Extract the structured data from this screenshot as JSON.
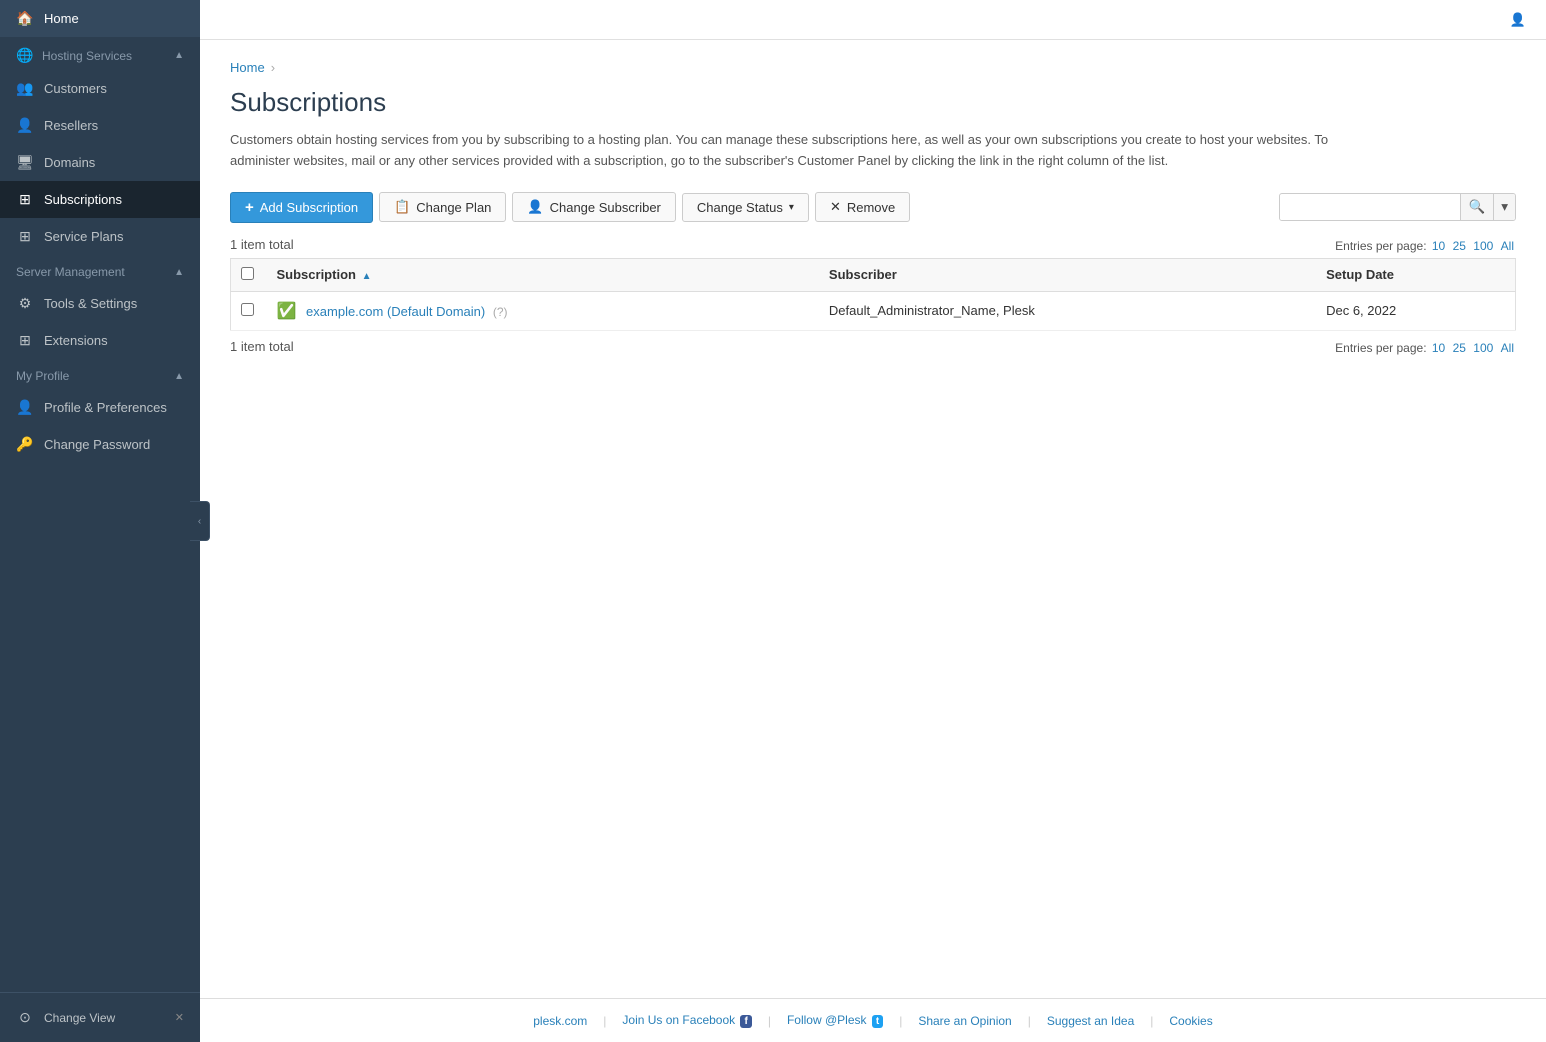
{
  "sidebar": {
    "home_label": "Home",
    "hosting_services_label": "Hosting Services",
    "customers_label": "Customers",
    "resellers_label": "Resellers",
    "domains_label": "Domains",
    "subscriptions_label": "Subscriptions",
    "service_plans_label": "Service Plans",
    "server_management_label": "Server Management",
    "tools_settings_label": "Tools & Settings",
    "extensions_label": "Extensions",
    "my_profile_label": "My Profile",
    "profile_preferences_label": "Profile & Preferences",
    "change_password_label": "Change Password",
    "change_view_label": "Change View",
    "collapse_label": "‹"
  },
  "topbar": {
    "user_icon": "👤"
  },
  "breadcrumb": {
    "home": "Home",
    "separator": "›"
  },
  "page": {
    "title": "Subscriptions",
    "description": "Customers obtain hosting services from you by subscribing to a hosting plan. You can manage these subscriptions here, as well as your own subscriptions you create to host your websites. To administer websites, mail or any other services provided with a subscription, go to the subscriber's Customer Panel by clicking the link in the right column of the list."
  },
  "toolbar": {
    "add_subscription": "Add Subscription",
    "change_plan": "Change Plan",
    "change_subscriber": "Change Subscriber",
    "change_status": "Change Status",
    "remove": "Remove"
  },
  "table": {
    "item_count": "1 item total",
    "entries_label": "Entries per page:",
    "entries_options": [
      "10",
      "25",
      "100",
      "All"
    ],
    "columns": [
      "Subscription",
      "Subscriber",
      "Setup Date"
    ],
    "rows": [
      {
        "subscription": "example.com (Default Domain)",
        "subscription_hint": "(?)",
        "subscriber": "Default_Administrator_Name, Plesk",
        "setup_date": "Dec 6, 2022"
      }
    ],
    "footer_item_count": "1 item total"
  },
  "footer": {
    "plesk_com": "plesk.com",
    "join_facebook": "Join Us on Facebook",
    "follow_plesk": "Follow @Plesk",
    "share_idea": "Share an Opinion",
    "suggest_idea": "Suggest an Idea",
    "cookies": "Cookies"
  }
}
